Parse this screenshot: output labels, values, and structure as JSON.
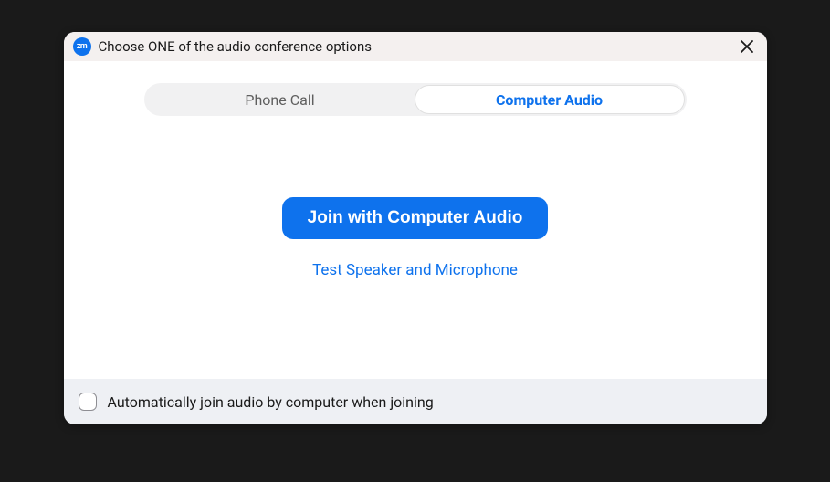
{
  "titlebar": {
    "icon_text": "zm",
    "title": "Choose ONE of the audio conference options"
  },
  "tabs": {
    "phone_call": "Phone Call",
    "computer_audio": "Computer Audio"
  },
  "main": {
    "join_button": "Join with Computer Audio",
    "test_link": "Test Speaker and Microphone"
  },
  "footer": {
    "checkbox_label": "Automatically join audio by computer when joining"
  }
}
